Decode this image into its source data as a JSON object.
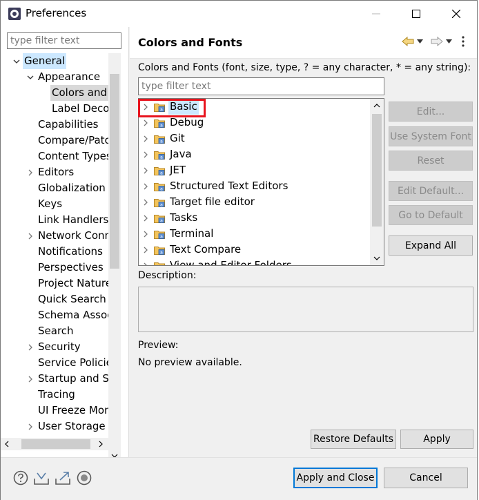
{
  "window": {
    "title": "Preferences"
  },
  "left": {
    "filter_placeholder": "type filter text",
    "tree": [
      {
        "label": "General",
        "level": 0,
        "twisty": "expanded",
        "state": "selected-blue"
      },
      {
        "label": "Appearance",
        "level": 1,
        "twisty": "expanded"
      },
      {
        "label": "Colors and",
        "level": 2,
        "twisty": "none",
        "state": "selected-gray"
      },
      {
        "label": "Label Decor",
        "level": 2,
        "twisty": "none"
      },
      {
        "label": "Capabilities",
        "level": 1,
        "twisty": "none"
      },
      {
        "label": "Compare/Patch",
        "level": 1,
        "twisty": "none"
      },
      {
        "label": "Content Types",
        "level": 1,
        "twisty": "none"
      },
      {
        "label": "Editors",
        "level": 1,
        "twisty": "collapsed"
      },
      {
        "label": "Globalization",
        "level": 1,
        "twisty": "none"
      },
      {
        "label": "Keys",
        "level": 1,
        "twisty": "none"
      },
      {
        "label": "Link Handlers",
        "level": 1,
        "twisty": "none"
      },
      {
        "label": "Network Conn",
        "level": 1,
        "twisty": "collapsed"
      },
      {
        "label": "Notifications",
        "level": 1,
        "twisty": "none"
      },
      {
        "label": "Perspectives",
        "level": 1,
        "twisty": "none"
      },
      {
        "label": "Project Natures",
        "level": 1,
        "twisty": "none"
      },
      {
        "label": "Quick Search",
        "level": 1,
        "twisty": "none"
      },
      {
        "label": "Schema Associ",
        "level": 1,
        "twisty": "none"
      },
      {
        "label": "Search",
        "level": 1,
        "twisty": "none"
      },
      {
        "label": "Security",
        "level": 1,
        "twisty": "collapsed"
      },
      {
        "label": "Service Policies",
        "level": 1,
        "twisty": "none"
      },
      {
        "label": "Startup and Sh",
        "level": 1,
        "twisty": "collapsed"
      },
      {
        "label": "Tracing",
        "level": 1,
        "twisty": "none"
      },
      {
        "label": "UI Freeze Mon",
        "level": 1,
        "twisty": "none"
      },
      {
        "label": "User Storage S",
        "level": 1,
        "twisty": "collapsed"
      }
    ]
  },
  "right": {
    "title": "Colors and Fonts",
    "cf_label": "Colors and Fonts (font, size, type, ? = any character, * = any string):",
    "cf_filter_placeholder": "type filter text",
    "categories": [
      {
        "label": "Basic",
        "selected": true
      },
      {
        "label": "Debug"
      },
      {
        "label": "Git"
      },
      {
        "label": "Java"
      },
      {
        "label": "JET"
      },
      {
        "label": "Structured Text Editors"
      },
      {
        "label": "Target file editor"
      },
      {
        "label": "Tasks"
      },
      {
        "label": "Terminal"
      },
      {
        "label": "Text Compare"
      },
      {
        "label": "View and Editor Folders"
      }
    ],
    "buttons": {
      "edit": "Edit...",
      "use_system_font": "Use System Font",
      "reset": "Reset",
      "edit_default": "Edit Default...",
      "go_to_default": "Go to Default",
      "expand_all": "Expand All"
    },
    "description_label": "Description:",
    "preview_label": "Preview:",
    "preview_text": "No preview available.",
    "restore_defaults": "Restore Defaults",
    "apply": "Apply"
  },
  "footer": {
    "apply_and_close": "Apply and Close",
    "cancel": "Cancel",
    "icons": [
      "help-icon",
      "import-icon",
      "export-icon",
      "record-icon"
    ]
  },
  "colors": {
    "selection_blue": "#cce8ff",
    "selection_gray": "#d9d9d9",
    "highlight_red": "#e8141e",
    "primary_border": "#0078d7"
  }
}
